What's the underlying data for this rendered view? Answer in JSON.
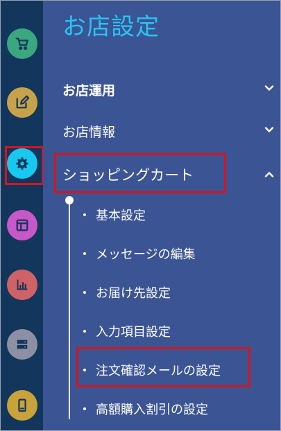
{
  "panel": {
    "title": "お店設定",
    "sections": [
      {
        "label": "お店運用",
        "expanded": false
      },
      {
        "label": "お店情報",
        "expanded": false
      },
      {
        "label": "ショッピングカート",
        "expanded": true
      }
    ],
    "cart_items": [
      "基本設定",
      "メッセージの編集",
      "お届け先設定",
      "入力項目設定",
      "注文確認メールの設定",
      "高額購入割引の設定"
    ]
  },
  "rail": {
    "icons": [
      {
        "name": "cart-icon",
        "color": "#3aa77f"
      },
      {
        "name": "edit-icon",
        "color": "#c7a24a"
      },
      {
        "name": "gear-icon",
        "color": "#18c8ef"
      },
      {
        "name": "layout-icon",
        "color": "#c857c7"
      },
      {
        "name": "bar-chart-icon",
        "color": "#cf6266"
      },
      {
        "name": "server-icon",
        "color": "#8f8fa3"
      },
      {
        "name": "mobile-icon",
        "color": "#c9a23a"
      }
    ]
  },
  "colors": {
    "rail_bg": "#12365c",
    "panel_bg": "#3b5494",
    "title": "#29c4f2",
    "highlight": "#d8141e"
  }
}
